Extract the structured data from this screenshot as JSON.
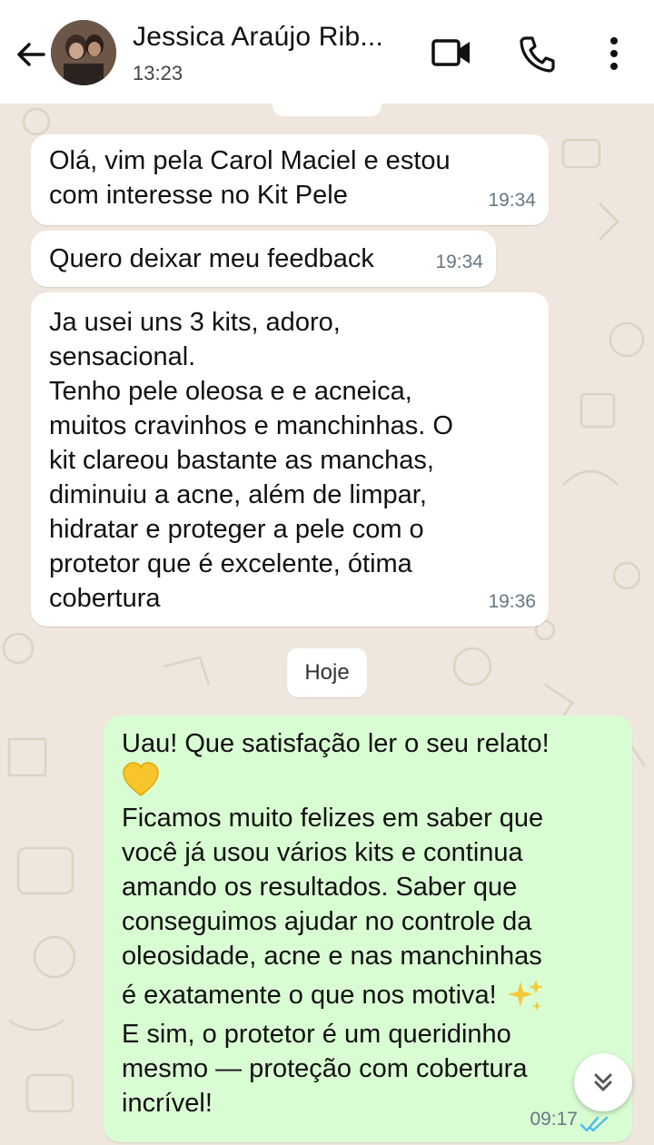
{
  "header": {
    "contact_name": "Jessica Araújo Rib...",
    "status_time": "13:23",
    "icons": [
      "back-arrow-icon",
      "avatar",
      "video-call-icon",
      "voice-call-icon",
      "more-options-icon"
    ]
  },
  "messages": [
    {
      "direction": "incoming",
      "text": "Olá, vim pela Carol Maciel e estou\ncom interesse no Kit Pele",
      "time": "19:34"
    },
    {
      "direction": "incoming",
      "text": "Quero deixar meu feedback",
      "time": "19:34"
    },
    {
      "direction": "incoming",
      "text": "Ja usei uns 3 kits, adoro,\nsensacional.\nTenho pele oleosa e e acneica,\nmuitos cravinhos e manchinhas. O\nkit clareou bastante as manchas,\ndiminuiu a acne, além de limpar,\nhidratar e proteger a pele com o\nprotetor que é excelente, ótima\ncobertura",
      "time": "19:36"
    }
  ],
  "date_separator": "Hoje",
  "outgoing": {
    "line1": "Uau! Que satisfação ler o seu relato!",
    "line2": "Ficamos muito felizes em saber que",
    "line3": "você já usou vários kits e continua",
    "line4": "amando os resultados. Saber que",
    "line5": "conseguimos ajudar no controle da",
    "line6": "oleosidade, acne e nas manchinhas",
    "line7": "é exatamente o que nos motiva!",
    "line8": "E sim, o protetor é um queridinho",
    "line9": "mesmo — proteção com cobertura",
    "line10": "incrível!",
    "time": "09:17",
    "status": "read"
  },
  "colors": {
    "outgoing_bubble": "#d9fdd3",
    "incoming_bubble": "#ffffff",
    "chat_background": "#efe7dd",
    "read_ticks": "#53bdeb"
  }
}
